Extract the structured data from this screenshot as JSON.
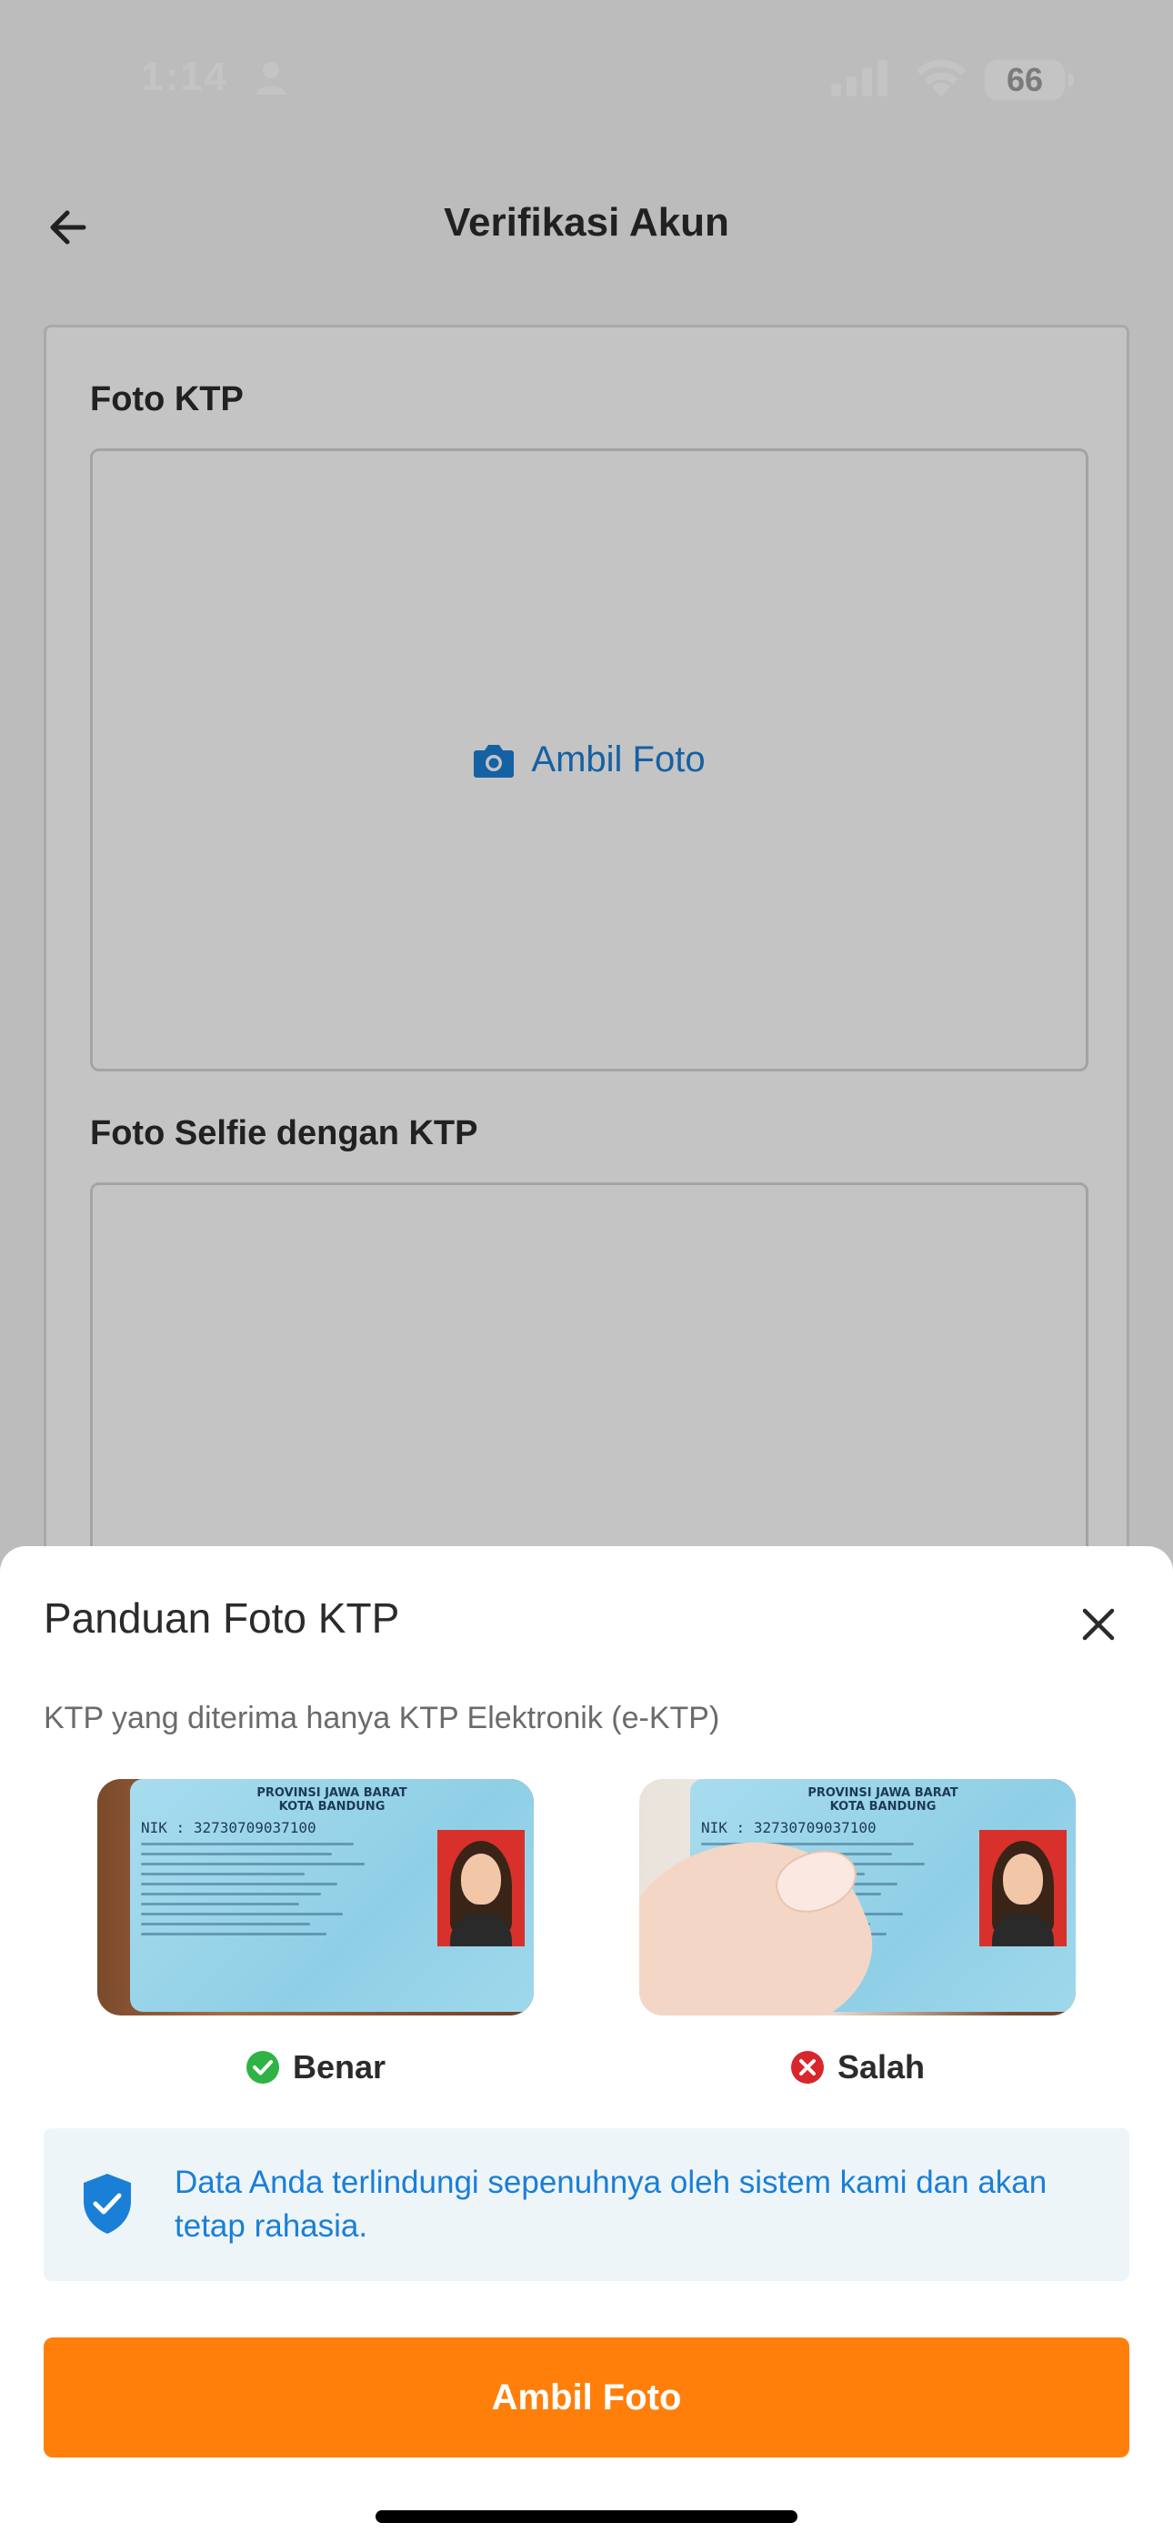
{
  "status_bar": {
    "time": "1:14",
    "battery": "66"
  },
  "header": {
    "title": "Verifikasi Akun"
  },
  "form": {
    "ktp_label": "Foto KTP",
    "ktp_button": "Ambil Foto",
    "selfie_label": "Foto Selfie dengan KTP"
  },
  "sheet": {
    "title": "Panduan Foto KTP",
    "subtitle": "KTP yang diterima hanya KTP Elektronik (e-KTP)",
    "examples": [
      {
        "status": "Benar",
        "status_color": "#2fb344"
      },
      {
        "status": "Salah",
        "status_color": "#d8262c"
      }
    ],
    "ktp_card": {
      "province": "PROVINSI JAWA BARAT",
      "city": "KOTA BANDUNG",
      "nik_label": "NIK",
      "nik": "32730709037100"
    },
    "info": "Data Anda terlindungi sepenuhnya oleh sistem kami dan akan tetap rahasia.",
    "primary_button": "Ambil Foto"
  },
  "colors": {
    "accent": "#ff7f0a",
    "link": "#1a7fd6",
    "info_bg": "#eef5f9"
  }
}
